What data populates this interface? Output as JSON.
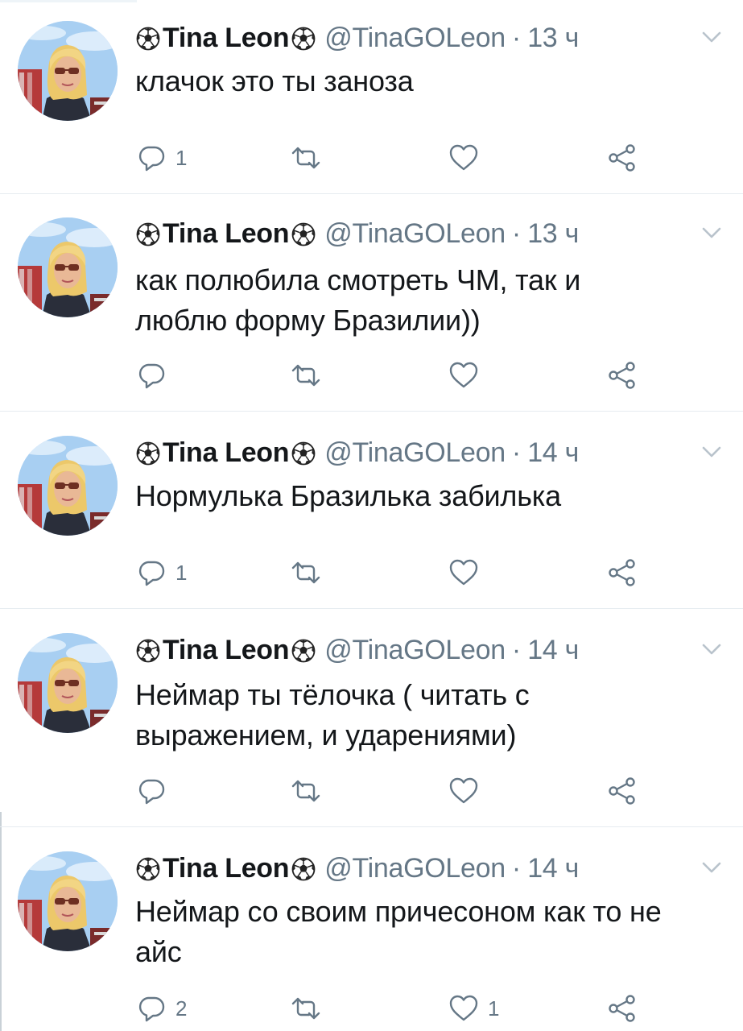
{
  "tweets": [
    {
      "name": "Tina Leon",
      "handle": "@TinaGOLeon",
      "time": "13 ч",
      "text": "клачок это ты заноза",
      "reply_count": "1",
      "retweet_count": "",
      "like_count": ""
    },
    {
      "name": "Tina Leon",
      "handle": "@TinaGOLeon",
      "time": "13 ч",
      "text": "как полюбила смотреть ЧМ, так и люблю форму Бразилии))",
      "reply_count": "",
      "retweet_count": "",
      "like_count": ""
    },
    {
      "name": "Tina Leon",
      "handle": "@TinaGOLeon",
      "time": "14 ч",
      "text": "Нормулька Бразилька забилька",
      "reply_count": "1",
      "retweet_count": "",
      "like_count": ""
    },
    {
      "name": "Tina Leon",
      "handle": "@TinaGOLeon",
      "time": "14 ч",
      "text": "Неймар ты тёлочка ( читать с выражением, и ударениями)",
      "reply_count": "",
      "retweet_count": "",
      "like_count": ""
    },
    {
      "name": "Tina Leon",
      "handle": "@TinaGOLeon",
      "time": "14 ч",
      "text": "Неймар со своим причесоном как то не айс",
      "reply_count": "2",
      "retweet_count": "",
      "like_count": "1"
    }
  ],
  "icons": {
    "name_prefix": "soccer-ball-icon",
    "name_suffix": "soccer-ball-icon",
    "menu": "chevron-down-icon",
    "reply": "reply-icon",
    "retweet": "retweet-icon",
    "like": "heart-icon",
    "share": "share-icon"
  },
  "colors": {
    "text": "#14171a",
    "secondary": "#657786",
    "divider": "#e6ecf0",
    "icon": "#657786"
  }
}
